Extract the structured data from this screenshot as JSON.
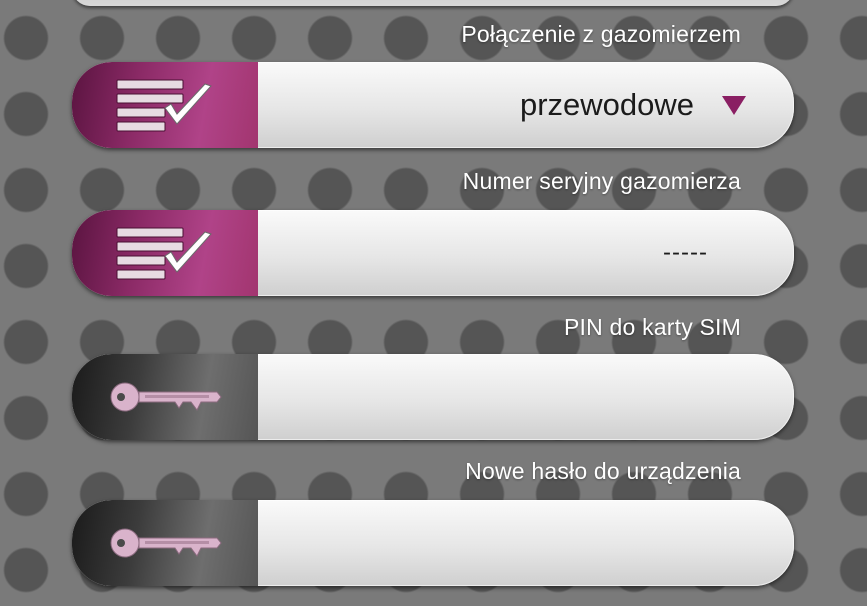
{
  "colors": {
    "accent": "#8b2a66",
    "dropdown_arrow": "#8a1f63",
    "label_text": "#ffffff",
    "field_background": "#e6e6e6",
    "page_background": "#7a7a7a"
  },
  "fields": [
    {
      "label": "Połączenie z gazomierzem",
      "icon": "checklist-icon",
      "value": "przewodowe",
      "control": "dropdown"
    },
    {
      "label": "Numer seryjny gazomierza",
      "icon": "checklist-icon",
      "value": "-----",
      "control": "text-field"
    },
    {
      "label": "PIN do karty SIM",
      "icon": "key-icon",
      "value": "",
      "control": "password-field"
    },
    {
      "label": "Nowe hasło do urządzenia",
      "icon": "key-icon",
      "value": "",
      "control": "password-field"
    }
  ]
}
